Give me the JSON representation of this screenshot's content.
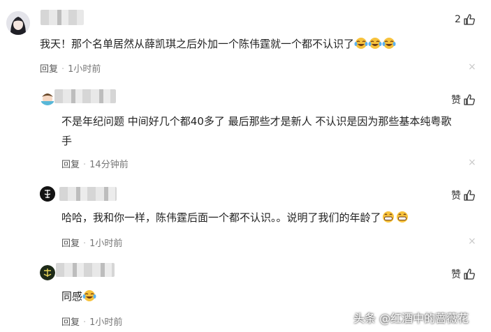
{
  "comments": [
    {
      "text": "我天！那个名单居然从薛凯琪之后外加一个陈伟霆就一个都不认识了",
      "emojis": [
        "laugh-cry",
        "laugh-cry",
        "laugh-cry"
      ],
      "reply_label": "回复",
      "time": "1小时前",
      "like_count": "2",
      "avatar_icon": "anime-girl-avatar-icon"
    },
    {
      "text": "不是年纪问题 中间好几个都40多了 最后那些才是新人 不认识是因为那些基本纯粤歌手",
      "emojis": [],
      "reply_label": "回复",
      "time": "14分钟前",
      "like_label": "赞",
      "avatar_icon": "cartoon-avatar-icon"
    },
    {
      "text": "哈哈，我和你一样，陈伟霆后面一个都不认识。。说明了我们的年龄了",
      "emojis": [
        "grin",
        "grin"
      ],
      "reply_label": "回复",
      "time": "1小时前",
      "like_label": "赞",
      "avatar_icon": "dark-calligraphy-avatar-icon"
    },
    {
      "text": "同感",
      "emojis": [
        "laugh-cry"
      ],
      "reply_label": "回复",
      "time": "1小时前",
      "like_label": "赞",
      "avatar_icon": "dark-green-logo-avatar-icon"
    }
  ],
  "separator": "·",
  "close_glyph": "×",
  "watermark": "头条 @红酒中的蔷薇花",
  "colors": {
    "emoji_face": "#f7c23c",
    "text": "#222222",
    "meta": "#777777"
  }
}
